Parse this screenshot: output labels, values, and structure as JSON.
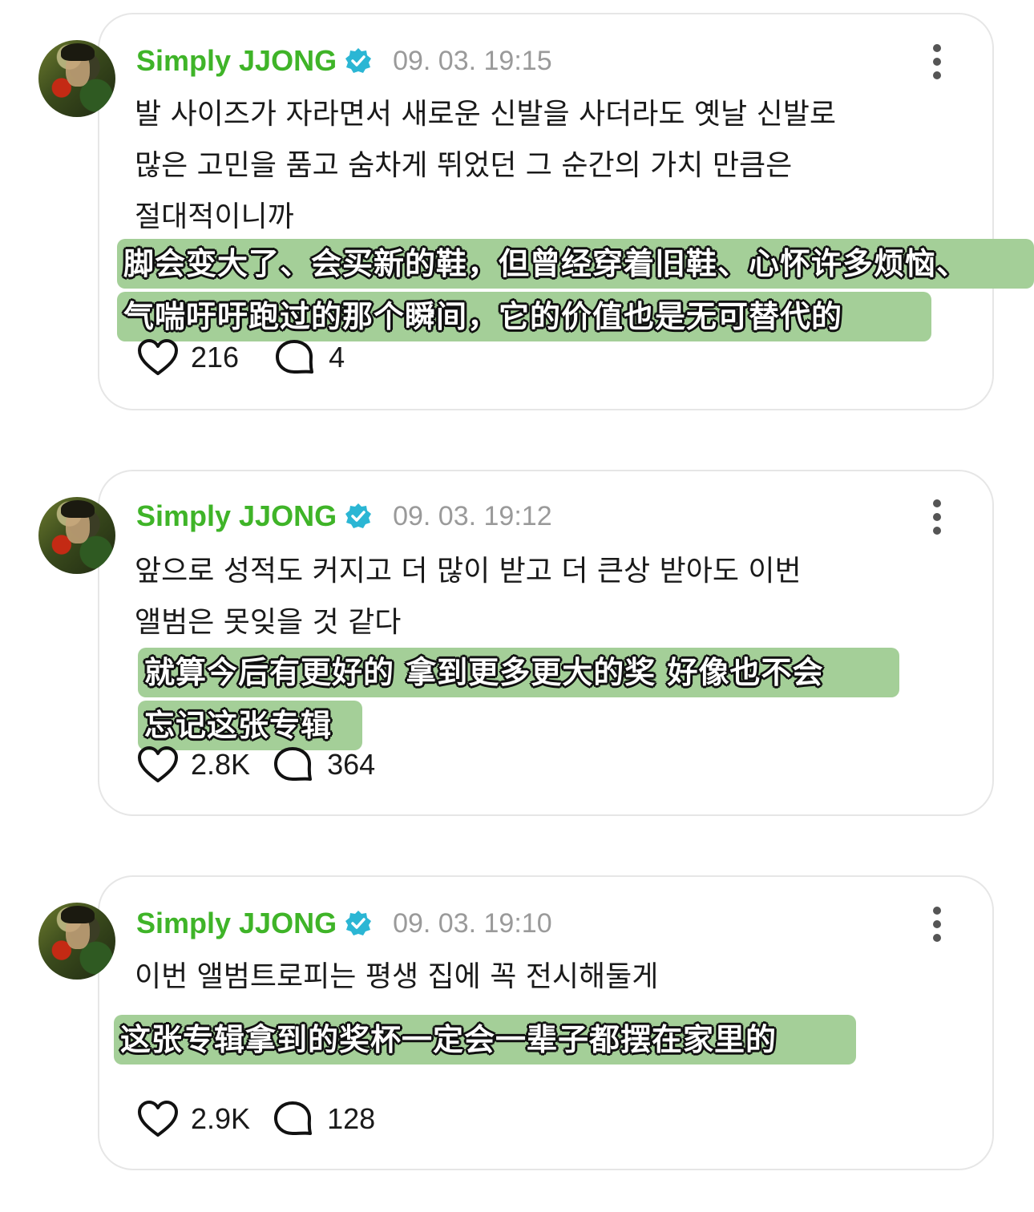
{
  "posts": [
    {
      "author": "Simply JJONG",
      "timestamp": "09. 03. 19:15",
      "body_lines": [
        "발 사이즈가 자라면서 새로운 신발을 사더라도 옛날 신발로",
        "많은 고민을 품고 숨차게 뛰었던 그 순간의 가치 만큼은",
        "절대적이니까"
      ],
      "subtitle_lines": [
        "脚会变大了、会买新的鞋，但曾经穿着旧鞋、心怀许多烦恼、",
        "气喘吁吁跑过的那个瞬间，它的价值也是无可替代的"
      ],
      "likes": "216",
      "replies": "4"
    },
    {
      "author": "Simply JJONG",
      "timestamp": "09. 03. 19:12",
      "body_lines": [
        "앞으로 성적도 커지고 더 많이 받고 더 큰상 받아도 이번",
        "앨범은 못잊을 것 같다"
      ],
      "subtitle_lines": [
        "就算今后有更好的 拿到更多更大的奖 好像也不会",
        "忘记这张专辑"
      ],
      "likes": "2.8K",
      "replies": "364"
    },
    {
      "author": "Simply JJONG",
      "timestamp": "09. 03. 19:10",
      "body_lines": [
        "이번 앨범트로피는 평생 집에 꼭 전시해둘게"
      ],
      "subtitle_lines": [
        "这张专辑拿到的奖杯一定会一辈子都摆在家里的"
      ],
      "likes": "2.9K",
      "replies": "128"
    }
  ],
  "colors": {
    "author": "#3fb428",
    "verified_badge": "#2bb6d4",
    "timestamp": "#9a9a9a",
    "subtitle_bg": "#a4cf98"
  },
  "icons": {
    "verified": "verified-badge-icon",
    "more": "more-vertical-icon",
    "like": "heart-icon",
    "reply": "comment-bubble-icon"
  }
}
